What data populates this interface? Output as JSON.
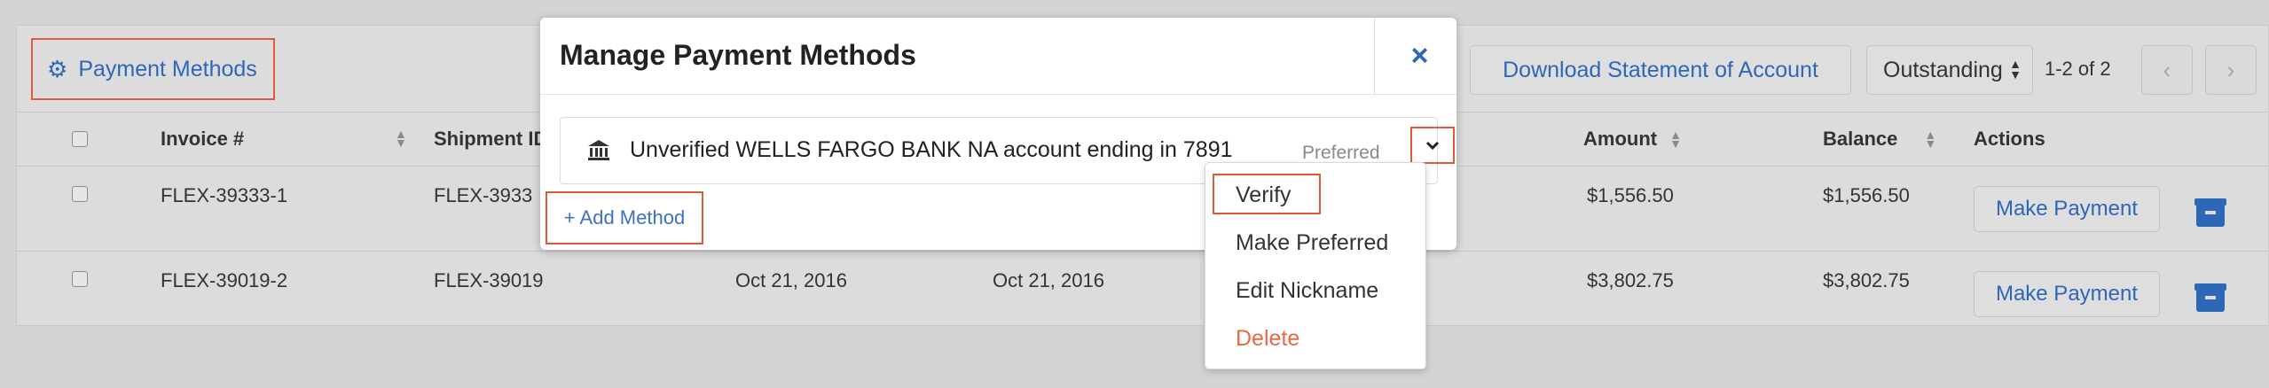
{
  "toolbar": {
    "payment_methods_label": "Payment Methods",
    "download_label": "Download Statement of Account",
    "status_value": "Outstanding",
    "pager_text": "1-2 of 2"
  },
  "table": {
    "columns": [
      "Invoice #",
      "Shipment ID",
      "Amount",
      "Balance",
      "Actions"
    ],
    "rows": [
      {
        "invoice": "FLEX-39333-1",
        "shipment": "FLEX-3933",
        "date1": "",
        "date2": "",
        "amount": "$1,556.50",
        "balance": "$1,556.50",
        "action": "Make Payment"
      },
      {
        "invoice": "FLEX-39019-2",
        "shipment": "FLEX-39019",
        "date1": "Oct 21, 2016",
        "date2": "Oct 21, 2016",
        "amount": "$3,802.75",
        "balance": "$3,802.75",
        "action": "Make Payment"
      }
    ]
  },
  "modal": {
    "title": "Manage Payment Methods",
    "close_glyph": "×",
    "method_text": "Unverified WELLS FARGO BANK NA account ending in 7891",
    "preferred_label": "Preferred",
    "add_method_label": "+ Add Method"
  },
  "dropdown": {
    "items": [
      "Verify",
      "Make Preferred",
      "Edit Nickname",
      "Delete"
    ]
  },
  "colors": {
    "accent": "#2f67b8",
    "highlight": "#e05a3a",
    "danger": "#e86a42"
  }
}
